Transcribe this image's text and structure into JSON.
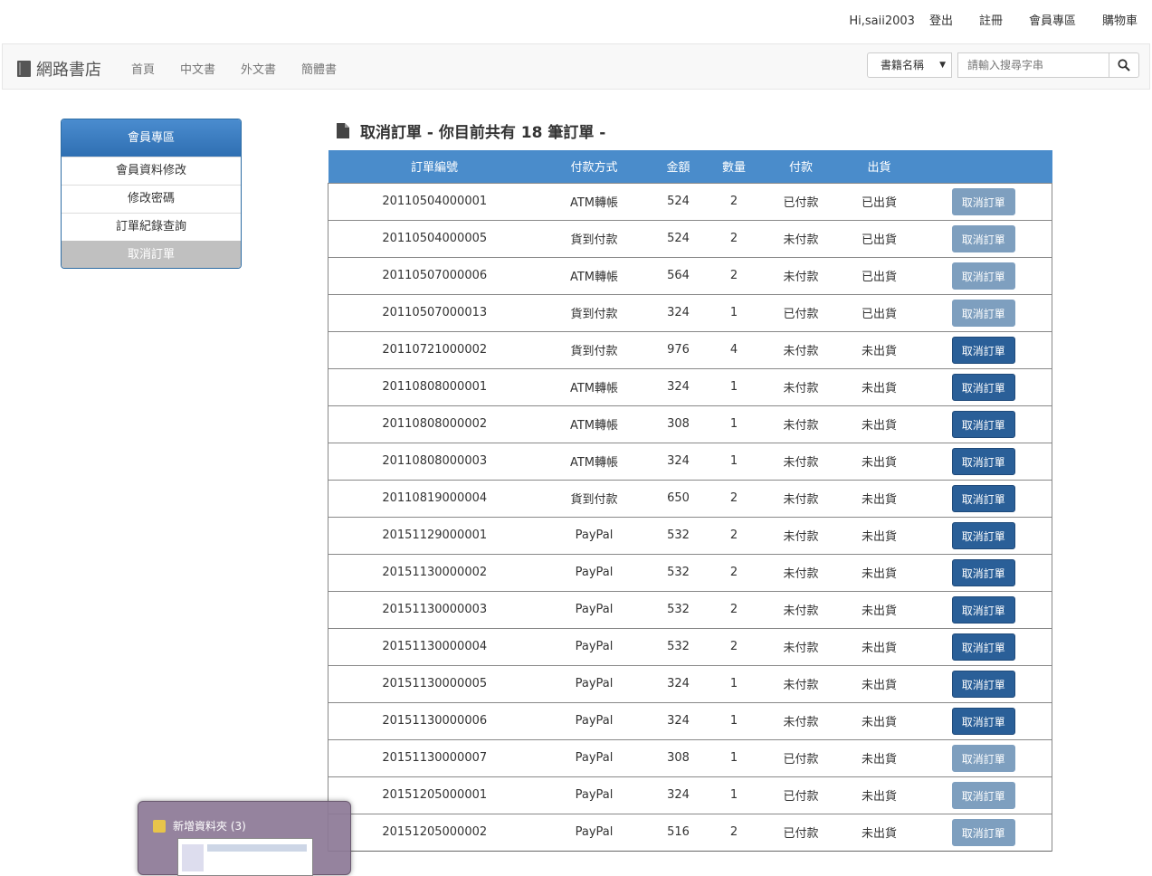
{
  "topbar": {
    "greeting": "Hi,saii2003",
    "links": [
      "登出",
      "註冊",
      "會員專區",
      "購物車"
    ]
  },
  "navbar": {
    "brand": "網路書店",
    "links": [
      "首頁",
      "中文書",
      "外文書",
      "簡體書"
    ],
    "search_select": "書籍名稱",
    "search_placeholder": "請輸入搜尋字串"
  },
  "sidebar": {
    "title": "會員專區",
    "items": [
      "會員資料修改",
      "修改密碼",
      "訂單紀錄查詢",
      "取消訂單"
    ],
    "active_index": 3
  },
  "page": {
    "title": "取消訂單 - 你目前共有 18 筆訂單 -"
  },
  "table": {
    "headers": [
      "訂單編號",
      "付款方式",
      "金額",
      "數量",
      "付款",
      "出貨",
      ""
    ],
    "button_label": "取消訂單",
    "rows": [
      {
        "id": "20110504000001",
        "pay": "ATM轉帳",
        "amount": "524",
        "qty": "2",
        "paid": "已付款",
        "ship": "已出貨",
        "enabled": false
      },
      {
        "id": "20110504000005",
        "pay": "貨到付款",
        "amount": "524",
        "qty": "2",
        "paid": "未付款",
        "ship": "已出貨",
        "enabled": false
      },
      {
        "id": "20110507000006",
        "pay": "ATM轉帳",
        "amount": "564",
        "qty": "2",
        "paid": "未付款",
        "ship": "已出貨",
        "enabled": false
      },
      {
        "id": "20110507000013",
        "pay": "貨到付款",
        "amount": "324",
        "qty": "1",
        "paid": "已付款",
        "ship": "已出貨",
        "enabled": false
      },
      {
        "id": "20110721000002",
        "pay": "貨到付款",
        "amount": "976",
        "qty": "4",
        "paid": "未付款",
        "ship": "未出貨",
        "enabled": true
      },
      {
        "id": "20110808000001",
        "pay": "ATM轉帳",
        "amount": "324",
        "qty": "1",
        "paid": "未付款",
        "ship": "未出貨",
        "enabled": true
      },
      {
        "id": "20110808000002",
        "pay": "ATM轉帳",
        "amount": "308",
        "qty": "1",
        "paid": "未付款",
        "ship": "未出貨",
        "enabled": true
      },
      {
        "id": "20110808000003",
        "pay": "ATM轉帳",
        "amount": "324",
        "qty": "1",
        "paid": "未付款",
        "ship": "未出貨",
        "enabled": true
      },
      {
        "id": "20110819000004",
        "pay": "貨到付款",
        "amount": "650",
        "qty": "2",
        "paid": "未付款",
        "ship": "未出貨",
        "enabled": true
      },
      {
        "id": "20151129000001",
        "pay": "PayPal",
        "amount": "532",
        "qty": "2",
        "paid": "未付款",
        "ship": "未出貨",
        "enabled": true
      },
      {
        "id": "20151130000002",
        "pay": "PayPal",
        "amount": "532",
        "qty": "2",
        "paid": "未付款",
        "ship": "未出貨",
        "enabled": true
      },
      {
        "id": "20151130000003",
        "pay": "PayPal",
        "amount": "532",
        "qty": "2",
        "paid": "未付款",
        "ship": "未出貨",
        "enabled": true
      },
      {
        "id": "20151130000004",
        "pay": "PayPal",
        "amount": "532",
        "qty": "2",
        "paid": "未付款",
        "ship": "未出貨",
        "enabled": true
      },
      {
        "id": "20151130000005",
        "pay": "PayPal",
        "amount": "324",
        "qty": "1",
        "paid": "未付款",
        "ship": "未出貨",
        "enabled": true
      },
      {
        "id": "20151130000006",
        "pay": "PayPal",
        "amount": "324",
        "qty": "1",
        "paid": "未付款",
        "ship": "未出貨",
        "enabled": true
      },
      {
        "id": "20151130000007",
        "pay": "PayPal",
        "amount": "308",
        "qty": "1",
        "paid": "已付款",
        "ship": "未出貨",
        "enabled": false
      },
      {
        "id": "20151205000001",
        "pay": "PayPal",
        "amount": "324",
        "qty": "1",
        "paid": "已付款",
        "ship": "未出貨",
        "enabled": false
      },
      {
        "id": "20151205000002",
        "pay": "PayPal",
        "amount": "516",
        "qty": "2",
        "paid": "已付款",
        "ship": "未出貨",
        "enabled": false
      }
    ]
  },
  "taskbar_thumbnail": {
    "title": "新增資料夾 (3)"
  },
  "colors": {
    "header_blue": "#4a8ccb",
    "button_enabled": "#2a5f98",
    "button_disabled": "#7e9fbf",
    "sidebar_active": "#c0c0c0"
  }
}
